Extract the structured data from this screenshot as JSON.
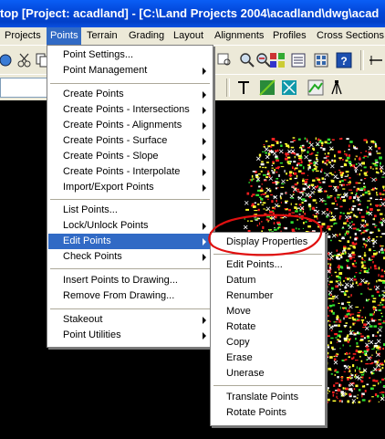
{
  "window": {
    "title": "top [Project: acadland] - [C:\\Land Projects 2004\\acadland\\dwg\\acad"
  },
  "menubar": {
    "items": [
      {
        "label": "Projects"
      },
      {
        "label": "Points"
      },
      {
        "label": "Terrain"
      },
      {
        "label": "Grading"
      },
      {
        "label": "Layout"
      },
      {
        "label": "Alignments"
      },
      {
        "label": "Profiles"
      },
      {
        "label": "Cross Sections"
      }
    ]
  },
  "points_menu": {
    "items": [
      {
        "label": "Point Settings..."
      },
      {
        "label": "Point Management",
        "submenu": true
      },
      {
        "label": "Create Points",
        "submenu": true
      },
      {
        "label": "Create Points - Intersections",
        "submenu": true
      },
      {
        "label": "Create Points - Alignments",
        "submenu": true
      },
      {
        "label": "Create Points - Surface",
        "submenu": true
      },
      {
        "label": "Create Points - Slope",
        "submenu": true
      },
      {
        "label": "Create Points - Interpolate",
        "submenu": true
      },
      {
        "label": "Import/Export Points",
        "submenu": true
      },
      {
        "label": "List Points..."
      },
      {
        "label": "Lock/Unlock Points",
        "submenu": true
      },
      {
        "label": "Edit Points",
        "submenu": true,
        "highlighted": true
      },
      {
        "label": "Check Points",
        "submenu": true
      },
      {
        "label": "Insert Points to Drawing..."
      },
      {
        "label": "Remove From Drawing..."
      },
      {
        "label": "Stakeout",
        "submenu": true
      },
      {
        "label": "Point Utilities",
        "submenu": true
      }
    ]
  },
  "edit_points_submenu": {
    "items": [
      {
        "label": "Display Properties",
        "circled": true
      },
      {
        "label": "Edit Points..."
      },
      {
        "label": "Datum"
      },
      {
        "label": "Renumber"
      },
      {
        "label": "Move"
      },
      {
        "label": "Rotate"
      },
      {
        "label": "Copy"
      },
      {
        "label": "Erase"
      },
      {
        "label": "Unerase"
      },
      {
        "label": "Translate Points"
      },
      {
        "label": "Rotate Points"
      }
    ]
  },
  "annotation": {
    "color": "#e01010"
  },
  "colors": {
    "highlight": "#316ac5",
    "menubar": "#ece9d8",
    "canvas": "#000000"
  }
}
